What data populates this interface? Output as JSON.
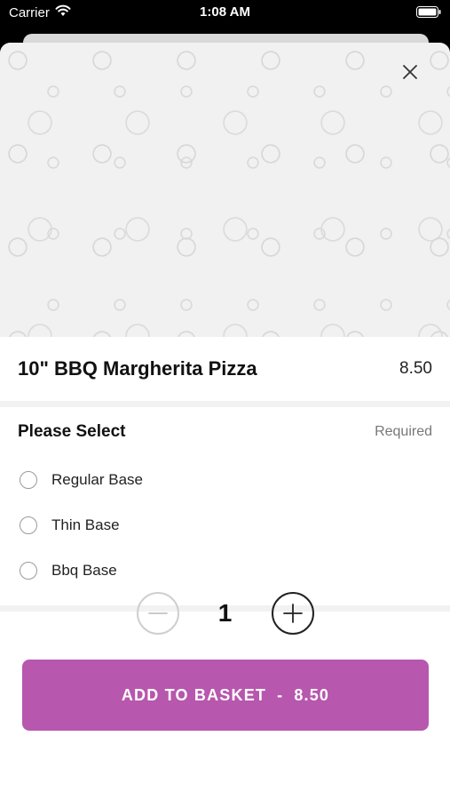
{
  "status_bar": {
    "carrier": "Carrier",
    "time": "1:08 AM",
    "wifi_icon": "wifi-icon",
    "battery_icon": "battery-icon"
  },
  "product": {
    "title": "10\" BBQ Margherita Pizza",
    "price": "8.50",
    "hero_image": "food-doodle-pattern"
  },
  "options_section": {
    "title": "Please Select",
    "requirement": "Required",
    "options": [
      {
        "label": "Regular Base",
        "selected": false
      },
      {
        "label": "Thin Base",
        "selected": false
      },
      {
        "label": "Bbq Base",
        "selected": false
      }
    ]
  },
  "quantity": {
    "value": "1",
    "decrement_icon": "minus-icon",
    "increment_icon": "plus-icon"
  },
  "add_button": {
    "label": "ADD TO BASKET",
    "separator": "-",
    "price": "8.50",
    "color": "#b757ad"
  }
}
